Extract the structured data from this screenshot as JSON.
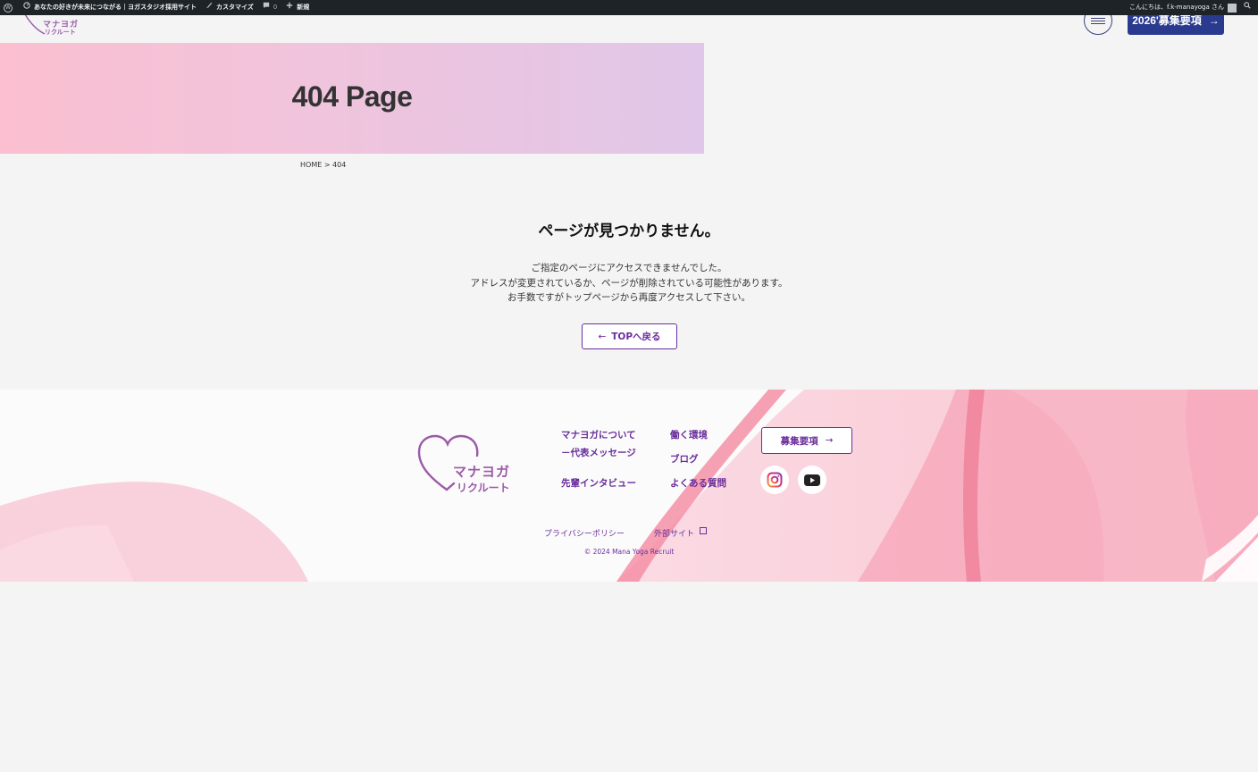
{
  "admin_bar": {
    "site_name": "あなたの好きが未来につながる｜ヨガスタジオ採用サイト",
    "customize": "カスタマイズ",
    "comments_count": "0",
    "new": "新規",
    "greeting": "こんにちは、f.k-manayoga さん"
  },
  "header": {
    "logo_line1": "マナヨガ",
    "logo_line2": "リクルート",
    "recruit_button": "2026'募集要項",
    "recruit_arrow": "→"
  },
  "hero": {
    "title": "404 Page"
  },
  "breadcrumb": "HOME > 404",
  "not_found": {
    "title": "ページが見つかりません。",
    "lines": [
      "ご指定のページにアクセスできませんでした。",
      "アドレスが変更されているか、ページが削除されている可能性があります。",
      "お手数ですがトップページから再度アクセスして下さい。"
    ],
    "back_arrow": "←",
    "back_label": "TOPへ戻る"
  },
  "footer": {
    "logo_line1": "マナヨガ",
    "logo_line2": "リクルート",
    "links": {
      "about": "マナヨガについて",
      "message": "－代表メッセージ",
      "interview": "先輩インタビュー",
      "environment": "働く環境",
      "blog": "ブログ",
      "faq": "よくある質問"
    },
    "recruit_button": "募集要項",
    "recruit_arrow": "→",
    "privacy": "プライバシーポリシー",
    "external": "外部サイト",
    "copyright": "© 2024 Mana Yoga Recruit"
  },
  "colors": {
    "admin_bar": "#1d2327",
    "accent_purple": "#6a2e9c",
    "navy_button": "#2a3b8f",
    "pink": "#f8a5b8"
  },
  "icons": [
    "wordpress-logo-icon",
    "dashboard-icon",
    "customize-brush-icon",
    "comment-icon",
    "plus-icon",
    "search-icon",
    "hamburger-icon",
    "instagram-icon",
    "youtube-icon",
    "external-link-icon"
  ]
}
